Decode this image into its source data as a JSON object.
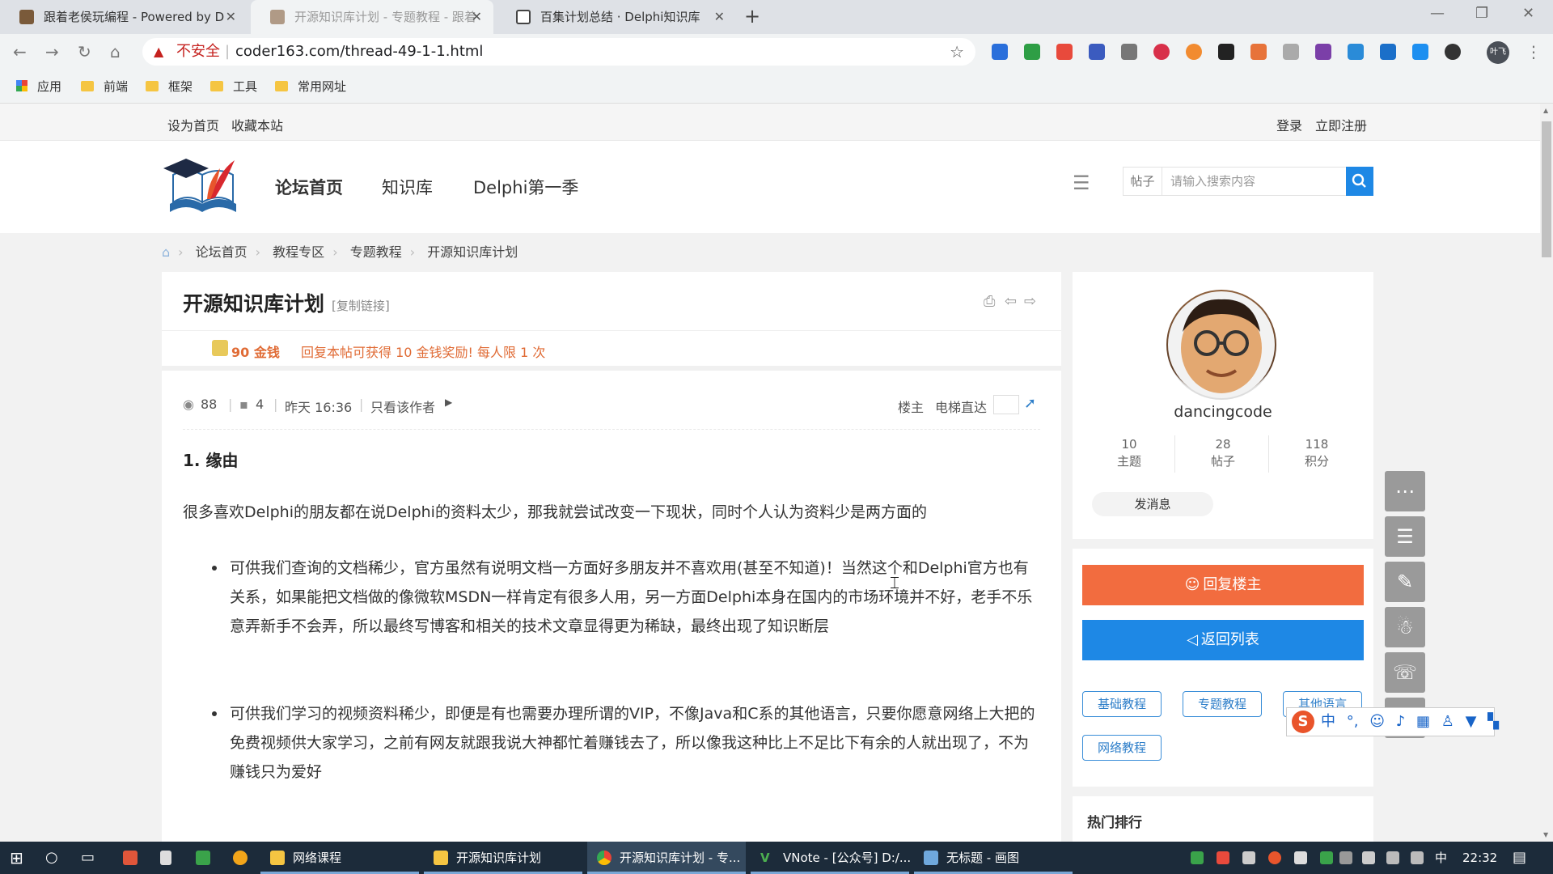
{
  "browser": {
    "tabs": [
      {
        "title": "跟着老侯玩编程 - Powered by D"
      },
      {
        "title": "开源知识库计划 - 专题教程 - 跟着"
      },
      {
        "title": "百集计划总结 · Delphi知识库"
      }
    ],
    "new_tab": "+",
    "insecure_label": "不安全",
    "url": "coder163.com/thread-49-1-1.html",
    "bookmarks": [
      "应用",
      "前端",
      "框架",
      "工具",
      "常用网址"
    ],
    "profile": "叶飞"
  },
  "page": {
    "topbar": {
      "left": [
        "设为首页",
        "收藏本站"
      ],
      "login": "登录",
      "register": "立即注册"
    },
    "nav": [
      "论坛首页",
      "知识库",
      "Delphi第一季"
    ],
    "search": {
      "type_label": "帖子",
      "placeholder": "请输入搜索内容"
    },
    "breadcrumb": [
      "论坛首页",
      "教程专区",
      "专题教程",
      "开源知识库计划"
    ],
    "thread": {
      "title": "开源知识库计划",
      "copy_link": "[复制链接]",
      "reward_amount": "90 金钱",
      "reward_text": "回复本帖可获得 10 金钱奖励! 每人限 1 次",
      "views": "88",
      "replies": "4",
      "time": "昨天 16:36",
      "author_only": "只看该作者",
      "floor_label": "楼主",
      "elevator_label": "电梯直达",
      "heading": "1. 缘由",
      "intro": "很多喜欢Delphi的朋友都在说Delphi的资料太少，那我就尝试改变一下现状，同时个人认为资料少是两方面的",
      "bullets": [
        "可供我们查询的文档稀少，官方虽然有说明文档一方面好多朋友并不喜欢用(甚至不知道)！当然这个和Delphi官方也有关系，如果能把文档做的像微软MSDN一样肯定有很多人用，另一方面Delphi本身在国内的市场环境并不好，老手不乐意弄新手不会弄，所以最终写博客和相关的技术文章显得更为稀缺，最终出现了知识断层",
        "可供我们学习的视频资料稀少，即便是有也需要办理所谓的VIP，不像Java和C系的其他语言，只要你愿意网络上大把的免费视频供大家学习，之前有网友就跟我说大神都忙着赚钱去了，所以像我这种比上不足比下有余的人就出现了，不为赚钱只为爱好"
      ]
    },
    "user": {
      "name": "dancingcode",
      "stats": [
        {
          "value": "10",
          "label": "主题"
        },
        {
          "value": "28",
          "label": "帖子"
        },
        {
          "value": "118",
          "label": "积分"
        }
      ],
      "message_button": "发消息"
    },
    "actions": {
      "reply": "回复楼主",
      "back": "返回列表"
    },
    "tags": [
      "基础教程",
      "专题教程",
      "其他语言",
      "网络教程"
    ],
    "hot_title": "热门排行"
  },
  "ime": {
    "logo": "S",
    "mode": "中"
  },
  "taskbar": {
    "apps": [
      "网络课程",
      "开源知识库计划",
      "开源知识库计划 - 专...",
      "VNote - [公众号] D:/...",
      "无标题 - 画图"
    ],
    "lang": "中",
    "time": "22:32"
  },
  "colors": {
    "reply_button": "#f26c3f",
    "back_button": "#1e88e5",
    "accent": "#1e88e5",
    "reward": "#e06b35"
  }
}
